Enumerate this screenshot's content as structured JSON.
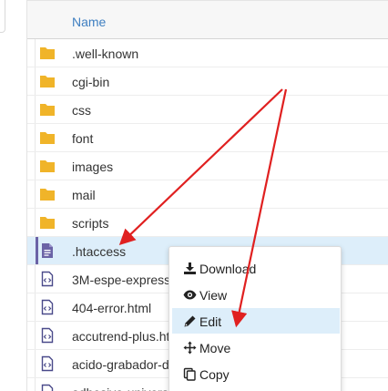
{
  "table": {
    "header_name": "Name",
    "rows": [
      {
        "name": ".well-known",
        "type": "folder"
      },
      {
        "name": "cgi-bin",
        "type": "folder"
      },
      {
        "name": "css",
        "type": "folder"
      },
      {
        "name": "font",
        "type": "folder"
      },
      {
        "name": "images",
        "type": "folder"
      },
      {
        "name": "mail",
        "type": "folder"
      },
      {
        "name": "scripts",
        "type": "folder"
      },
      {
        "name": ".htaccess",
        "type": "text-file"
      },
      {
        "name": "3M-espe-express",
        "type": "code-file"
      },
      {
        "name": "404-error.html",
        "type": "code-file"
      },
      {
        "name": "accutrend-plus.ht",
        "type": "code-file"
      },
      {
        "name": "acido-grabador-d",
        "type": "code-file"
      },
      {
        "name": "adhesivo-universa",
        "type": "code-file"
      }
    ]
  },
  "context_menu": {
    "items": [
      {
        "label": "Download",
        "icon": "download-icon"
      },
      {
        "label": "View",
        "icon": "eye-icon"
      },
      {
        "label": "Edit",
        "icon": "pencil-icon"
      },
      {
        "label": "Move",
        "icon": "move-icon"
      },
      {
        "label": "Copy",
        "icon": "copy-icon"
      }
    ]
  },
  "colors": {
    "folder": "#f0b429",
    "file_text": "#6b63a6",
    "file_code": "#4a4a8a",
    "link": "#3f7fc1",
    "selected_row": "#ddeefa",
    "arrow": "#e02020"
  }
}
